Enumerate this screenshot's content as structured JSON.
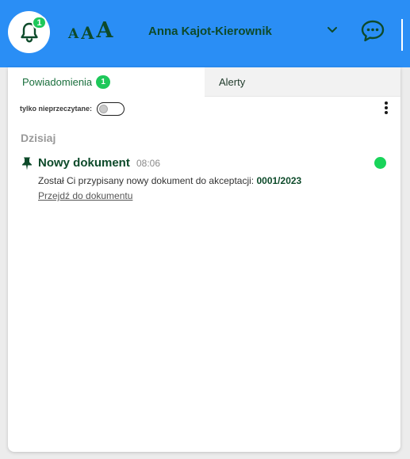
{
  "header": {
    "notifications_count": "1",
    "font_size_labels": {
      "small": "A",
      "medium": "A",
      "large": "A"
    },
    "user_name": "Anna Kajot-Kierownik"
  },
  "tabs": [
    {
      "label": "Powiadomienia",
      "badge": "1",
      "active": true
    },
    {
      "label": "Alerty",
      "active": false
    }
  ],
  "filter": {
    "label": "tylko nieprzeczytane:",
    "enabled": false
  },
  "sections": [
    {
      "title": "Dzisiaj",
      "items": [
        {
          "title": "Nowy dokument",
          "time": "08:06",
          "body_text": "Został Ci przypisany nowy dokument do akceptacji:",
          "document_number": "0001/2023",
          "link_text": "Przejdź do dokumentu",
          "unread": true,
          "pinned": true
        }
      ]
    }
  ],
  "colors": {
    "header_bg": "#2a8ef5",
    "brand_dark_green": "#0d4a2a",
    "badge_green": "#1ec85a",
    "unread_dot": "#19d45a"
  },
  "icons": {
    "bell": "bell-icon",
    "chevron": "chevron-down-icon",
    "chat": "chat-bubble-icon",
    "more": "more-vertical-icon",
    "pin": "pin-icon"
  }
}
